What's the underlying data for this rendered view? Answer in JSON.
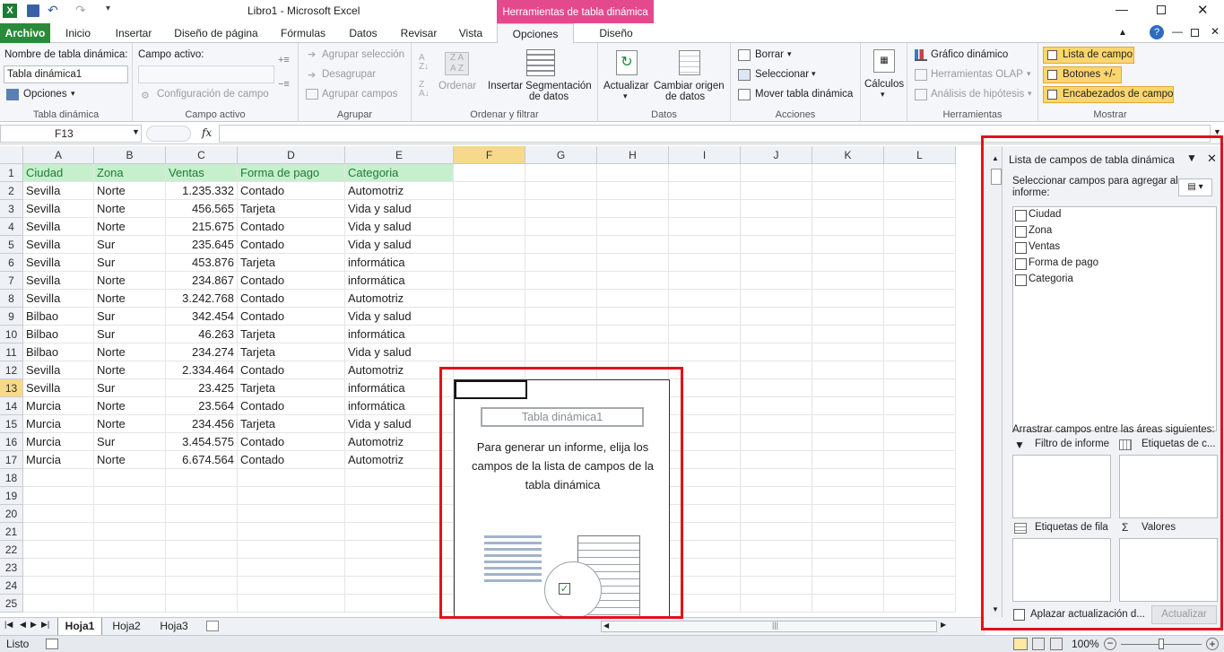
{
  "window": {
    "title": "Libro1 - Microsoft Excel",
    "context_tab": "Herramientas de tabla dinámica"
  },
  "tabs": [
    "Archivo",
    "Inicio",
    "Insertar",
    "Diseño de página",
    "Fórmulas",
    "Datos",
    "Revisar",
    "Vista",
    "Opciones",
    "Diseño"
  ],
  "ribbon": {
    "pivot_name_label": "Nombre de tabla dinámica:",
    "pivot_name_value": "Tabla dinámica1",
    "options": "Opciones",
    "group_pivot": "Tabla dinámica",
    "active_field_label": "Campo activo:",
    "field_config": "Configuración de campo",
    "group_active": "Campo activo",
    "group_selection": "Agrupar selección",
    "ungroup": "Desagrupar",
    "group_fields": "Agrupar campos",
    "group_group": "Agrupar",
    "sort": "Ordenar",
    "insert_slicer_1": "Insertar Segmentación",
    "insert_slicer_2": "de datos",
    "group_sort": "Ordenar y filtrar",
    "refresh": "Actualizar",
    "change_source_1": "Cambiar origen",
    "change_source_2": "de datos",
    "group_data": "Datos",
    "clear": "Borrar",
    "select": "Seleccionar",
    "move_pivot": "Mover tabla dinámica",
    "group_actions": "Acciones",
    "calculations": "Cálculos",
    "pivot_chart": "Gráfico dinámico",
    "olap_tools": "Herramientas OLAP",
    "whatif": "Análisis de hipótesis",
    "group_tools": "Herramientas",
    "field_list": "Lista de campo",
    "buttons": "Botones +/-",
    "field_headers": "Encabezados de campo",
    "group_show": "Mostrar"
  },
  "formula": {
    "name_box": "F13",
    "fx": "fx",
    "value": ""
  },
  "columns": [
    "A",
    "B",
    "C",
    "D",
    "E",
    "F",
    "G",
    "H",
    "I",
    "J",
    "K",
    "L"
  ],
  "rows": [
    "1",
    "2",
    "3",
    "4",
    "5",
    "6",
    "7",
    "8",
    "9",
    "10",
    "11",
    "12",
    "13",
    "14",
    "15",
    "16",
    "17",
    "18",
    "19",
    "20",
    "21",
    "22",
    "23",
    "24",
    "25"
  ],
  "table": {
    "headers": [
      "Ciudad",
      "Zona",
      "Ventas",
      "Forma de pago",
      "Categoria"
    ],
    "rows": [
      [
        "Sevilla",
        "Norte",
        "1.235.332",
        "Contado",
        "Automotriz"
      ],
      [
        "Sevilla",
        "Norte",
        "456.565",
        "Tarjeta",
        "Vida y salud"
      ],
      [
        "Sevilla",
        "Norte",
        "215.675",
        "Contado",
        "Vida y salud"
      ],
      [
        "Sevilla",
        "Sur",
        "235.645",
        "Contado",
        "Vida y salud"
      ],
      [
        "Sevilla",
        "Sur",
        "453.876",
        "Tarjeta",
        "informática"
      ],
      [
        "Sevilla",
        "Norte",
        "234.867",
        "Contado",
        "informática"
      ],
      [
        "Sevilla",
        "Norte",
        "3.242.768",
        "Contado",
        "Automotriz"
      ],
      [
        "Bilbao",
        "Sur",
        "342.454",
        "Contado",
        "Vida y salud"
      ],
      [
        "Bilbao",
        "Sur",
        "46.263",
        "Tarjeta",
        "informática"
      ],
      [
        "Bilbao",
        "Norte",
        "234.274",
        "Tarjeta",
        "Vida y salud"
      ],
      [
        "Sevilla",
        "Norte",
        "2.334.464",
        "Contado",
        "Automotriz"
      ],
      [
        "Sevilla",
        "Sur",
        "23.425",
        "Tarjeta",
        "informática"
      ],
      [
        "Murcia",
        "Norte",
        "23.564",
        "Contado",
        "informática"
      ],
      [
        "Murcia",
        "Norte",
        "234.456",
        "Tarjeta",
        "Vida y salud"
      ],
      [
        "Murcia",
        "Sur",
        "3.454.575",
        "Contado",
        "Automotriz"
      ],
      [
        "Murcia",
        "Norte",
        "6.674.564",
        "Contado",
        "Automotriz"
      ]
    ]
  },
  "pivot_placeholder": {
    "name": "Tabla dinámica1",
    "message": "Para generar un informe, elija los campos de la lista de campos de la tabla dinámica"
  },
  "field_list": {
    "title": "Lista de campos de tabla dinámica",
    "select_label": "Seleccionar campos para agregar al informe:",
    "fields": [
      "Ciudad",
      "Zona",
      "Ventas",
      "Forma de pago",
      "Categoria"
    ],
    "drag_label": "Arrastrar campos entre las áreas siguientes:",
    "report_filter": "Filtro de informe",
    "column_labels": "Etiquetas de c...",
    "row_labels": "Etiquetas de fila",
    "values": "Valores",
    "defer": "Aplazar actualización d...",
    "update": "Actualizar"
  },
  "sheets": [
    "Hoja1",
    "Hoja2",
    "Hoja3"
  ],
  "status": {
    "ready": "Listo",
    "zoom": "100%"
  },
  "colors": {
    "file_tab": "#2a8a3a",
    "context": "#e34a8e",
    "header_fill": "#c6efce",
    "header_text": "#1e7b34",
    "highlight": "#e3111b"
  }
}
